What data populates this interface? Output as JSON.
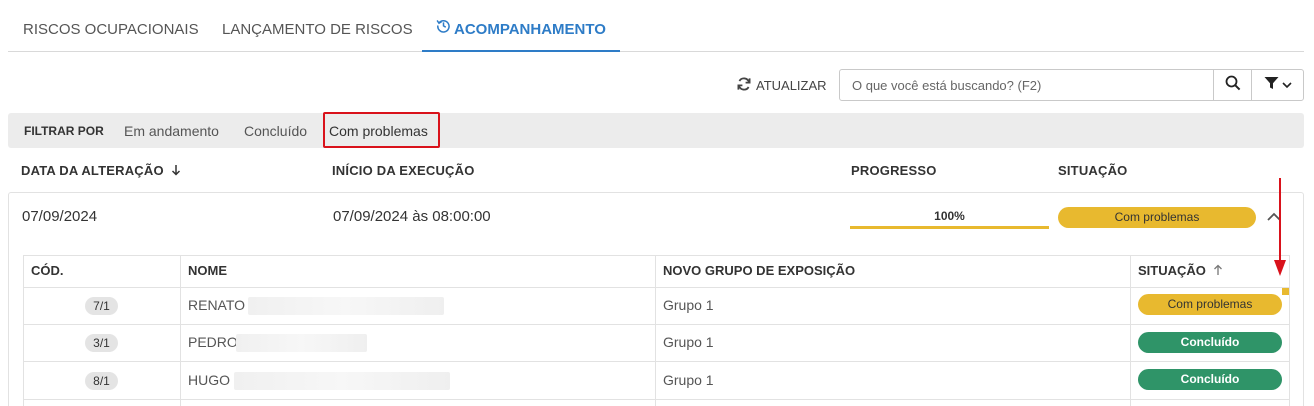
{
  "tabs": [
    {
      "label": "RISCOS OCUPACIONAIS"
    },
    {
      "label": "LANÇAMENTO DE RISCOS"
    },
    {
      "label": "ACOMPANHAMENTO",
      "icon": "history-icon",
      "active": true
    }
  ],
  "toolbar": {
    "refresh_label": "ATUALIZAR",
    "search_placeholder": "O que você está buscando? (F2)"
  },
  "filter": {
    "label": "FILTRAR POR",
    "options": [
      "Em andamento",
      "Concluído",
      "Com problemas"
    ],
    "highlighted": "Com problemas"
  },
  "columns": {
    "date": "DATA DA ALTERAÇÃO",
    "start": "INÍCIO DA EXECUÇÃO",
    "progress": "PROGRESSO",
    "status": "SITUAÇÃO"
  },
  "record": {
    "date": "07/09/2024",
    "start": "07/09/2024 às 08:00:00",
    "progress_label": "100%",
    "progress_percent": 100,
    "status": "Com problemas"
  },
  "detail_table": {
    "headers": {
      "code": "CÓD.",
      "name": "NOME",
      "group": "NOVO GRUPO DE EXPOSIÇÃO",
      "status": "SITUAÇÃO"
    },
    "rows": [
      {
        "code": "7/1",
        "name": "RENATO",
        "group": "Grupo 1",
        "status": "Com problemas",
        "status_type": "warning"
      },
      {
        "code": "3/1",
        "name": "PEDRO",
        "group": "Grupo 1",
        "status": "Concluído",
        "status_type": "success"
      },
      {
        "code": "8/1",
        "name": "HUGO",
        "group": "Grupo 1",
        "status": "Concluído",
        "status_type": "success"
      }
    ]
  },
  "colors": {
    "accent": "#2e7cc7",
    "warning": "#e8b92f",
    "success": "#2f9468",
    "annotation": "#d9121b"
  }
}
